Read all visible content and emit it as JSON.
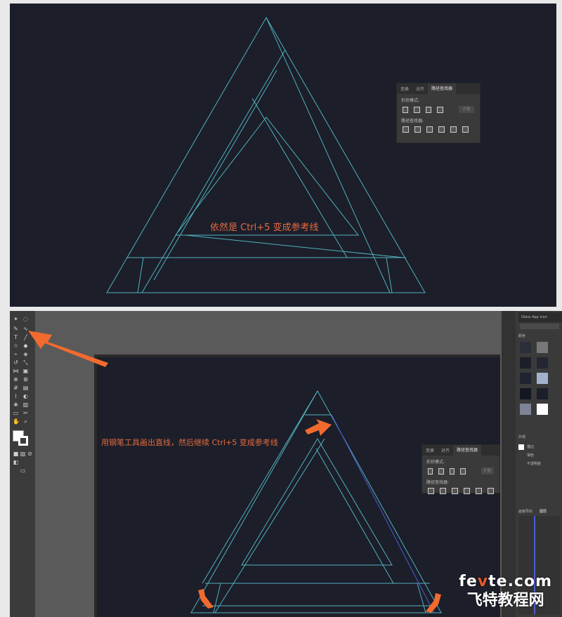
{
  "top_caption": "依然是 Ctrl+5 变成参考线",
  "bottom_caption": "用钢笔工具画出直线，然后继续 Ctrl+5 变成参考线",
  "pathfinder": {
    "tabs": [
      "变换",
      "对齐",
      "路径查找器"
    ],
    "active_tab": "路径查找器",
    "shape_modes_label": "形状模式:",
    "pathfinders_label": "路径查找器:",
    "expand_label": "扩展"
  },
  "layers": {
    "doc_title": "Glass App icon",
    "panel_label": "颜色",
    "appearance_label": "外观",
    "stroke_label": "描边",
    "fill_label": "填色",
    "opacity_label": "不透明度",
    "tabs": [
      "画板导出",
      "图层"
    ]
  },
  "watermark": {
    "line1_pre": "fe",
    "line1_accent": "v",
    "line1_post": "te.com",
    "line2": "飞特教程网"
  },
  "colors": {
    "guide": "#4fb3bd",
    "guide_blue": "#4a5ed0",
    "canvas": "#1c1e2a",
    "accent": "#e46b3e",
    "arrow": "#f26a2e"
  }
}
